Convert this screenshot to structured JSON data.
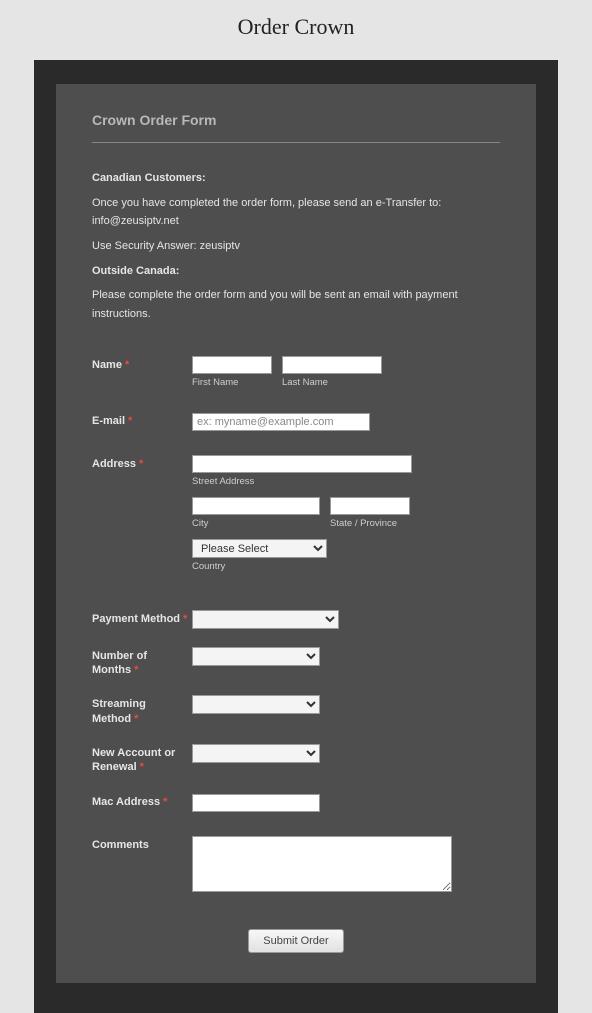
{
  "page": {
    "title": "Order Crown"
  },
  "form": {
    "title": "Crown Order Form",
    "info": {
      "canadian_heading": "Canadian Customers:",
      "canadian_line": "Once you have completed the order form, please send an e-Transfer to:  info@zeusiptv.net",
      "security_line": "Use Security Answer:  zeusiptv",
      "outside_heading": "Outside Canada:",
      "outside_line": "Please complete the order form and you will be sent an email with payment instructions."
    },
    "fields": {
      "name": {
        "label": "Name",
        "first_value": "",
        "last_value": "",
        "first_sub": "First Name",
        "last_sub": "Last Name"
      },
      "email": {
        "label": "E-mail",
        "value": "",
        "placeholder": "ex: myname@example.com"
      },
      "address": {
        "label": "Address",
        "street_value": "",
        "street_sub": "Street Address",
        "city_value": "",
        "city_sub": "City",
        "state_value": "",
        "state_sub": "State / Province",
        "country_value": "Please Select",
        "country_sub": "Country"
      },
      "payment": {
        "label": "Payment Method",
        "value": ""
      },
      "months": {
        "label": "Number of Months",
        "value": ""
      },
      "streaming": {
        "label": "Streaming Method",
        "value": ""
      },
      "account": {
        "label": "New Account or Renewal",
        "value": ""
      },
      "mac": {
        "label": "Mac Address",
        "value": ""
      },
      "comments": {
        "label": "Comments",
        "value": ""
      }
    },
    "submit_label": "Submit Order"
  }
}
